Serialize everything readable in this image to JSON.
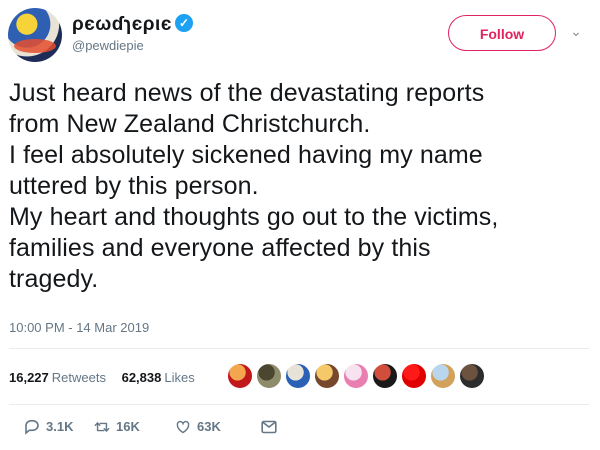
{
  "header": {
    "display_name": "ρєωɗɿєριє",
    "handle": "@pewdiepie",
    "follow_label": "Follow"
  },
  "tweet": {
    "lines": [
      "Just heard news of the devastating reports",
      "from New Zealand Christchurch.",
      "I feel absolutely sickened having my name",
      "uttered by this person.",
      "My heart and thoughts go out to the victims,",
      "families and everyone affected by this",
      "tragedy."
    ],
    "timestamp": "10:00 PM - 14 Mar 2019"
  },
  "stats": {
    "retweets_count": "16,227",
    "retweets_label": "Retweets",
    "likes_count": "62,838",
    "likes_label": "Likes"
  },
  "liker_avatars": [
    {
      "name": "avatar-red-orb",
      "colors": [
        "#f3a64d",
        "#c1181c"
      ]
    },
    {
      "name": "avatar-dark-circle",
      "colors": [
        "#4b4630",
        "#8e8c6b"
      ]
    },
    {
      "name": "avatar-blue-splash",
      "colors": [
        "#e7e3d8",
        "#2a61b7"
      ]
    },
    {
      "name": "avatar-yellow-face",
      "colors": [
        "#f5c86a",
        "#76492f"
      ]
    },
    {
      "name": "avatar-pink-hair",
      "colors": [
        "#f7e3ef",
        "#e97fb1"
      ]
    },
    {
      "name": "avatar-red-checker",
      "colors": [
        "#d24e3c",
        "#1a1a1a"
      ]
    },
    {
      "name": "avatar-red-dot",
      "colors": [
        "#ff1a1a",
        "#e00000"
      ]
    },
    {
      "name": "avatar-blue-sky",
      "colors": [
        "#b9d6ee",
        "#d2a25d"
      ]
    },
    {
      "name": "avatar-dark-face",
      "colors": [
        "#6b5340",
        "#2d2d2d"
      ]
    }
  ],
  "actions": {
    "reply_count": "3.1K",
    "retweet_count": "16K",
    "like_count": "63K"
  },
  "colors": {
    "follow_accent": "#e0245e",
    "verified_blue": "#1da1f2",
    "muted_text": "#657786"
  }
}
